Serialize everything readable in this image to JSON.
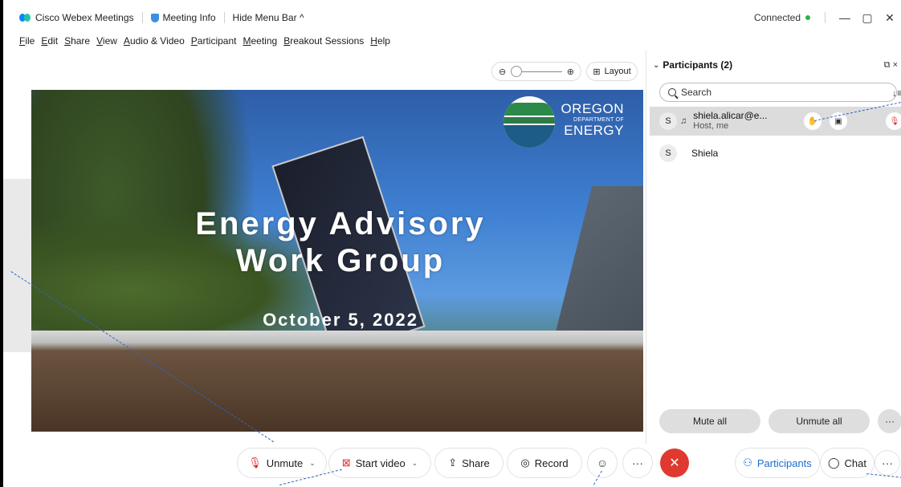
{
  "titlebar": {
    "app_name": "Cisco Webex Meetings",
    "meeting_info": "Meeting Info",
    "hide_menu": "Hide Menu Bar",
    "hide_menu_chevron": "^",
    "status": "Connected",
    "minimize": "—",
    "restore": "▢",
    "close": "✕"
  },
  "menu": [
    "File",
    "Edit",
    "Share",
    "View",
    "Audio & Video",
    "Participant",
    "Meeting",
    "Breakout Sessions",
    "Help"
  ],
  "stage": {
    "zoom_out": "⊖",
    "zoom_in": "⊕",
    "layout_label": "Layout"
  },
  "slide": {
    "title_line1": "Energy Advisory",
    "title_line2": "Work Group",
    "date": "October 5, 2022",
    "org_line1": "OREGON",
    "org_line2": "DEPARTMENT OF",
    "org_line3": "ENERGY"
  },
  "participants_panel": {
    "header": "Participants (2)",
    "popout": "⧉",
    "close": "×",
    "search_placeholder": "Search",
    "sort_icon": "↓≡",
    "participants": [
      {
        "initial": "S",
        "name": "shiela.alicar@e...",
        "role": "Host, me"
      },
      {
        "initial": "S",
        "name": "Shiela",
        "role": ""
      }
    ],
    "mute_all": "Mute all",
    "unmute_all": "Unmute all",
    "more": "···"
  },
  "toolbar": {
    "unmute": "Unmute",
    "start_video": "Start video",
    "share": "Share",
    "record": "Record",
    "reactions": "☺",
    "more": "···",
    "leave": "✕",
    "participants": "Participants",
    "chat": "Chat",
    "more_right": "···"
  },
  "colors": {
    "accent_blue": "#1d6fd0",
    "leave_red": "#e0392f",
    "connected_green": "#2bb24c",
    "mute_red": "#e02b2b"
  }
}
